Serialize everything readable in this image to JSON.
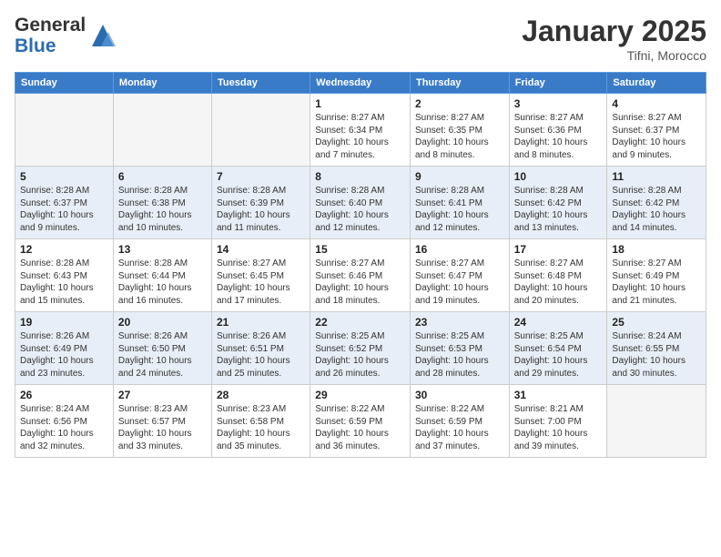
{
  "header": {
    "logo_line1": "General",
    "logo_line2": "Blue",
    "month_title": "January 2025",
    "location": "Tifni, Morocco"
  },
  "days_of_week": [
    "Sunday",
    "Monday",
    "Tuesday",
    "Wednesday",
    "Thursday",
    "Friday",
    "Saturday"
  ],
  "weeks": [
    [
      {
        "day": "",
        "info": ""
      },
      {
        "day": "",
        "info": ""
      },
      {
        "day": "",
        "info": ""
      },
      {
        "day": "1",
        "info": "Sunrise: 8:27 AM\nSunset: 6:34 PM\nDaylight: 10 hours\nand 7 minutes."
      },
      {
        "day": "2",
        "info": "Sunrise: 8:27 AM\nSunset: 6:35 PM\nDaylight: 10 hours\nand 8 minutes."
      },
      {
        "day": "3",
        "info": "Sunrise: 8:27 AM\nSunset: 6:36 PM\nDaylight: 10 hours\nand 8 minutes."
      },
      {
        "day": "4",
        "info": "Sunrise: 8:27 AM\nSunset: 6:37 PM\nDaylight: 10 hours\nand 9 minutes."
      }
    ],
    [
      {
        "day": "5",
        "info": "Sunrise: 8:28 AM\nSunset: 6:37 PM\nDaylight: 10 hours\nand 9 minutes."
      },
      {
        "day": "6",
        "info": "Sunrise: 8:28 AM\nSunset: 6:38 PM\nDaylight: 10 hours\nand 10 minutes."
      },
      {
        "day": "7",
        "info": "Sunrise: 8:28 AM\nSunset: 6:39 PM\nDaylight: 10 hours\nand 11 minutes."
      },
      {
        "day": "8",
        "info": "Sunrise: 8:28 AM\nSunset: 6:40 PM\nDaylight: 10 hours\nand 12 minutes."
      },
      {
        "day": "9",
        "info": "Sunrise: 8:28 AM\nSunset: 6:41 PM\nDaylight: 10 hours\nand 12 minutes."
      },
      {
        "day": "10",
        "info": "Sunrise: 8:28 AM\nSunset: 6:42 PM\nDaylight: 10 hours\nand 13 minutes."
      },
      {
        "day": "11",
        "info": "Sunrise: 8:28 AM\nSunset: 6:42 PM\nDaylight: 10 hours\nand 14 minutes."
      }
    ],
    [
      {
        "day": "12",
        "info": "Sunrise: 8:28 AM\nSunset: 6:43 PM\nDaylight: 10 hours\nand 15 minutes."
      },
      {
        "day": "13",
        "info": "Sunrise: 8:28 AM\nSunset: 6:44 PM\nDaylight: 10 hours\nand 16 minutes."
      },
      {
        "day": "14",
        "info": "Sunrise: 8:27 AM\nSunset: 6:45 PM\nDaylight: 10 hours\nand 17 minutes."
      },
      {
        "day": "15",
        "info": "Sunrise: 8:27 AM\nSunset: 6:46 PM\nDaylight: 10 hours\nand 18 minutes."
      },
      {
        "day": "16",
        "info": "Sunrise: 8:27 AM\nSunset: 6:47 PM\nDaylight: 10 hours\nand 19 minutes."
      },
      {
        "day": "17",
        "info": "Sunrise: 8:27 AM\nSunset: 6:48 PM\nDaylight: 10 hours\nand 20 minutes."
      },
      {
        "day": "18",
        "info": "Sunrise: 8:27 AM\nSunset: 6:49 PM\nDaylight: 10 hours\nand 21 minutes."
      }
    ],
    [
      {
        "day": "19",
        "info": "Sunrise: 8:26 AM\nSunset: 6:49 PM\nDaylight: 10 hours\nand 23 minutes."
      },
      {
        "day": "20",
        "info": "Sunrise: 8:26 AM\nSunset: 6:50 PM\nDaylight: 10 hours\nand 24 minutes."
      },
      {
        "day": "21",
        "info": "Sunrise: 8:26 AM\nSunset: 6:51 PM\nDaylight: 10 hours\nand 25 minutes."
      },
      {
        "day": "22",
        "info": "Sunrise: 8:25 AM\nSunset: 6:52 PM\nDaylight: 10 hours\nand 26 minutes."
      },
      {
        "day": "23",
        "info": "Sunrise: 8:25 AM\nSunset: 6:53 PM\nDaylight: 10 hours\nand 28 minutes."
      },
      {
        "day": "24",
        "info": "Sunrise: 8:25 AM\nSunset: 6:54 PM\nDaylight: 10 hours\nand 29 minutes."
      },
      {
        "day": "25",
        "info": "Sunrise: 8:24 AM\nSunset: 6:55 PM\nDaylight: 10 hours\nand 30 minutes."
      }
    ],
    [
      {
        "day": "26",
        "info": "Sunrise: 8:24 AM\nSunset: 6:56 PM\nDaylight: 10 hours\nand 32 minutes."
      },
      {
        "day": "27",
        "info": "Sunrise: 8:23 AM\nSunset: 6:57 PM\nDaylight: 10 hours\nand 33 minutes."
      },
      {
        "day": "28",
        "info": "Sunrise: 8:23 AM\nSunset: 6:58 PM\nDaylight: 10 hours\nand 35 minutes."
      },
      {
        "day": "29",
        "info": "Sunrise: 8:22 AM\nSunset: 6:59 PM\nDaylight: 10 hours\nand 36 minutes."
      },
      {
        "day": "30",
        "info": "Sunrise: 8:22 AM\nSunset: 6:59 PM\nDaylight: 10 hours\nand 37 minutes."
      },
      {
        "day": "31",
        "info": "Sunrise: 8:21 AM\nSunset: 7:00 PM\nDaylight: 10 hours\nand 39 minutes."
      },
      {
        "day": "",
        "info": ""
      }
    ]
  ]
}
